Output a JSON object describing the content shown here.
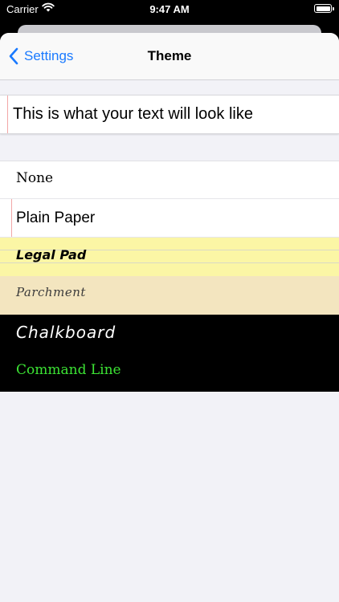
{
  "status_bar": {
    "carrier": "Carrier",
    "time": "9:47 AM"
  },
  "nav": {
    "back_label": "Settings",
    "title": "Theme"
  },
  "preview": {
    "text": "This is what your text will look like"
  },
  "themes": [
    {
      "label": "None"
    },
    {
      "label": "Plain Paper"
    },
    {
      "label": "Legal Pad"
    },
    {
      "label": "Parchment"
    },
    {
      "label": "Chalkboard"
    },
    {
      "label": "Command Line"
    }
  ],
  "colors": {
    "accent": "#1a7aff",
    "legal_pad": "#fbf6a5",
    "parchment": "#f3e5bf",
    "chalkboard": "#000000",
    "command_line_text": "#3ce334"
  }
}
